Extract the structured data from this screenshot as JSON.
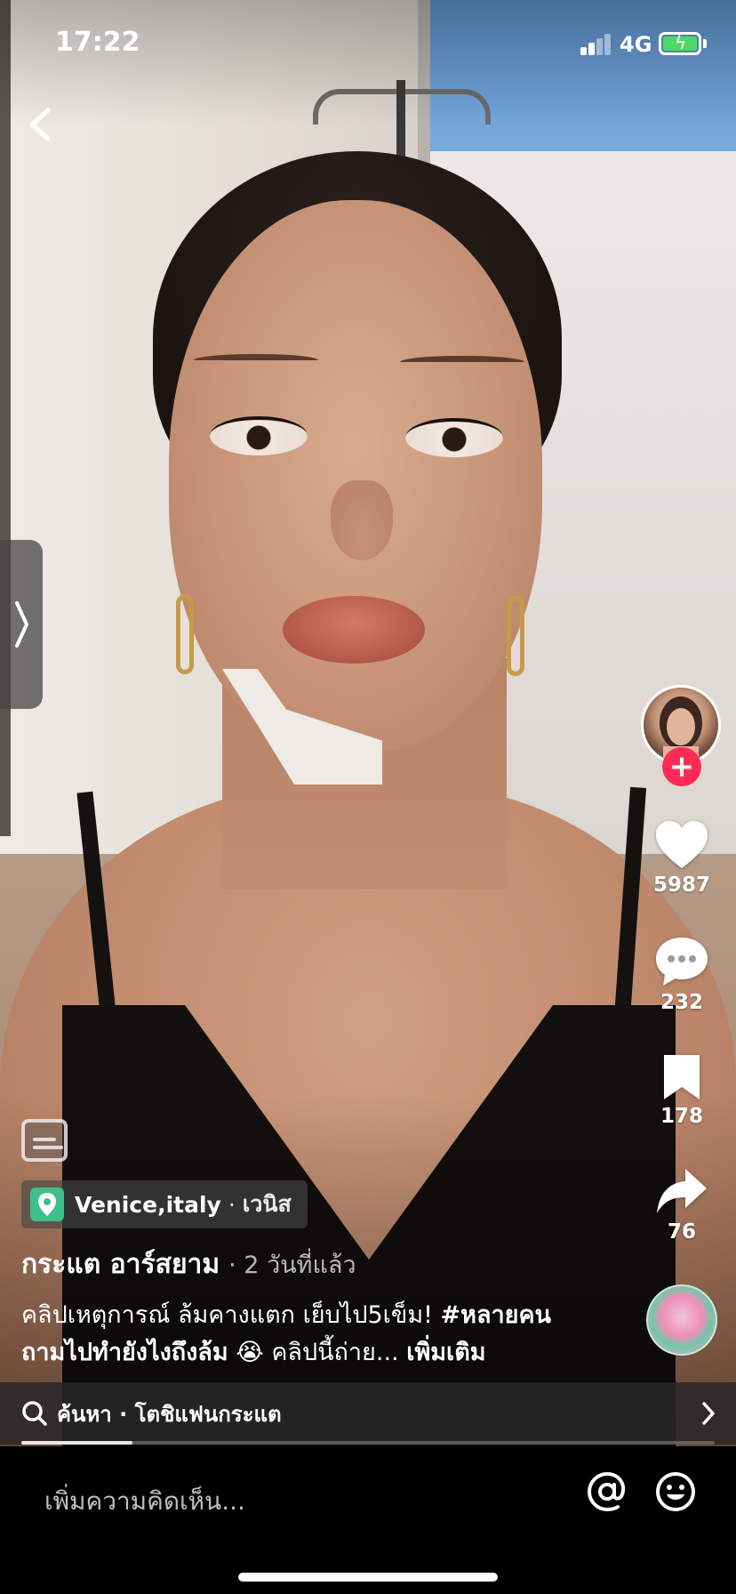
{
  "status_bar": {
    "time": "17:22",
    "network": "4G",
    "battery_charging": true
  },
  "location": {
    "name": "Venice,italy",
    "separator": "·",
    "local_name": "เวนิส"
  },
  "author": {
    "name": "กระแต อาร์สยาม",
    "time_ago": "· 2 วันที่แล้ว"
  },
  "caption": {
    "text": "คลิปเหตุการณ์ ล้มคางแตก เย็บไป5เข็ม! ",
    "hashtag": "#หลายคนถามไปทำยังไงถึงล้ม",
    "emoji": " 😭 ",
    "tail": "คลิปนี้ถ่าย... ",
    "more_label": "เพิ่มเติม"
  },
  "actions": {
    "likes": "5987",
    "comments": "232",
    "saves": "178",
    "shares": "76",
    "follow_symbol": "+"
  },
  "search": {
    "label": "ค้นหา · โตชิแฟนกระแต"
  },
  "playback": {
    "progress": 0.16
  },
  "comment_bar": {
    "placeholder": "เพิ่มความคิดเห็น..."
  },
  "icons": {
    "back": "chevron-left-icon",
    "side_handle": "chevron-right-icon",
    "like": "heart-icon",
    "comment": "comment-bubble-icon",
    "save": "bookmark-icon",
    "share": "share-arrow-icon",
    "captions": "closed-captions-icon",
    "location": "map-pin-icon",
    "search": "search-icon",
    "mention": "at-sign-icon",
    "emoji": "smiley-icon"
  },
  "colors": {
    "follow": "#fe2c55",
    "location_pin": "#3fbf8a",
    "battery": "#4cd964"
  }
}
